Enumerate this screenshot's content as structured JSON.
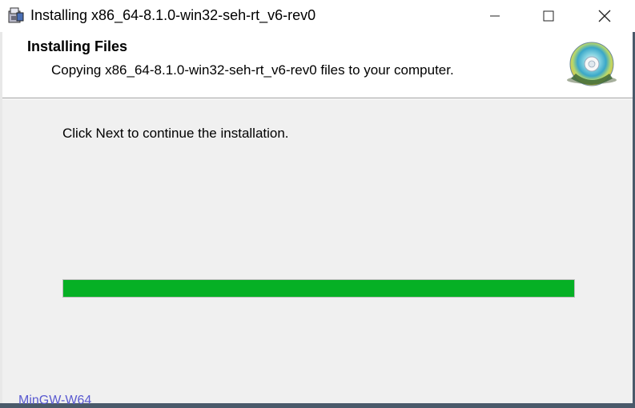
{
  "window": {
    "title": "Installing x86_64-8.1.0-win32-seh-rt_v6-rev0",
    "app_icon": "installer-icon",
    "minimize_icon": "minimize-icon",
    "maximize_icon": "maximize-icon",
    "close_icon": "close-icon"
  },
  "header": {
    "title": "Installing Files",
    "subtitle": "Copying x86_64-8.1.0-win32-seh-rt_v6-rev0 files to your computer.",
    "icon": "cd-disc-icon"
  },
  "body": {
    "message": "Click Next to continue the installation.",
    "progress_percent": 100,
    "progress_color": "#06b025"
  },
  "footer": {
    "brand": "MinGW-W64"
  }
}
